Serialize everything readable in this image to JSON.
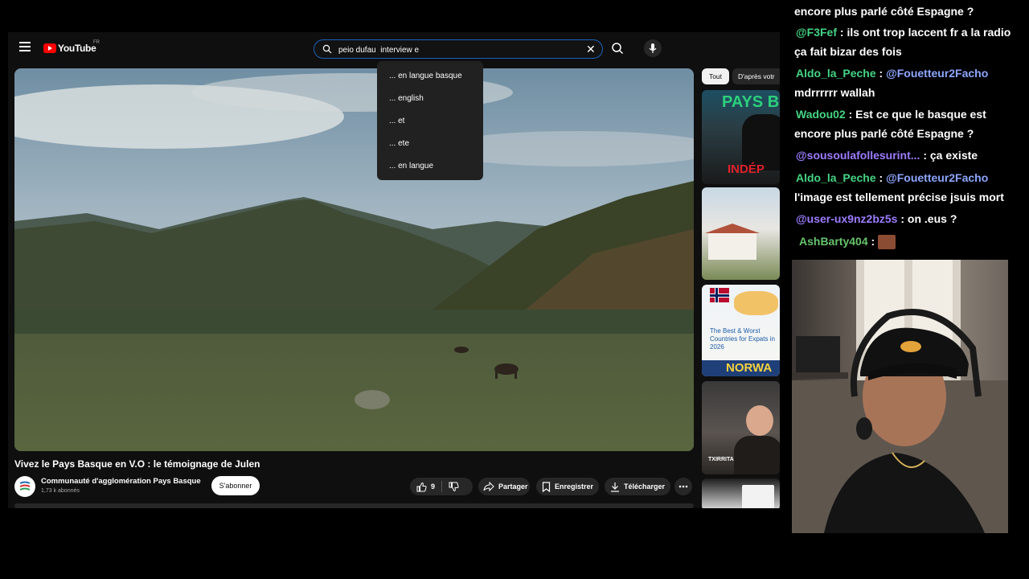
{
  "youtube": {
    "logo_text": "YouTube",
    "region": "FR",
    "search": {
      "value": "peio dufau  interview e",
      "clear_glyph": "✕"
    },
    "suggestions": [
      "... en langue basque",
      "... english",
      "... et",
      "... ete",
      "... en langue"
    ],
    "video": {
      "title": "Vivez le Pays Basque en V.O : le témoignage de Julen",
      "channel": "Communauté d'agglomération Pays Basque",
      "subscribers": "1,73 k abonnés",
      "subscribe_label": "S'abonner",
      "likes": "9",
      "share_label": "Partager",
      "save_label": "Enregistrer",
      "download_label": "Télécharger"
    },
    "chips": {
      "all": "Tout",
      "related": "D'après votr"
    },
    "thumbnails": [
      {
        "top_text": "PAYS B",
        "bottom_text": "INDÉP"
      },
      {},
      {
        "caption": "The Best & Worst Countries for Expats in 2026",
        "bottom_text": "NORWA"
      },
      {
        "caption": "TXIRRITA"
      },
      {}
    ]
  },
  "chat": [
    {
      "user": "",
      "user_color": "#9c7cff",
      "text": "encore plus parlé côté Espagne ?"
    },
    {
      "user": "@F3Fef",
      "user_color": "#45d483",
      "text": " : ils ont trop laccent fr a la radio ça fait bizar des fois"
    },
    {
      "user": "Aldo_la_Peche",
      "user_color": "#45d483",
      "mention": "@Fouetteur2Facho",
      "text": " mdrrrrrr wallah"
    },
    {
      "user": "Wadou02",
      "user_color": "#45d483",
      "text": " : Est ce que le basque est encore plus parlé côté Espagne ?"
    },
    {
      "user": "@sousoulafollesurint...",
      "user_color": "#9c7cff",
      "text": " : ça existe"
    },
    {
      "user": "Aldo_la_Peche",
      "user_color": "#45d483",
      "mention": "@Fouetteur2Facho",
      "text": " l'image est tellement précise jsuis mort"
    },
    {
      "user": "@user-ux9nz2bz5s",
      "user_color": "#9c7cff",
      "text": " : on .eus ?"
    },
    {
      "user": "AshBarty404",
      "user_color": "#66c46b",
      "text": " : "
    }
  ]
}
